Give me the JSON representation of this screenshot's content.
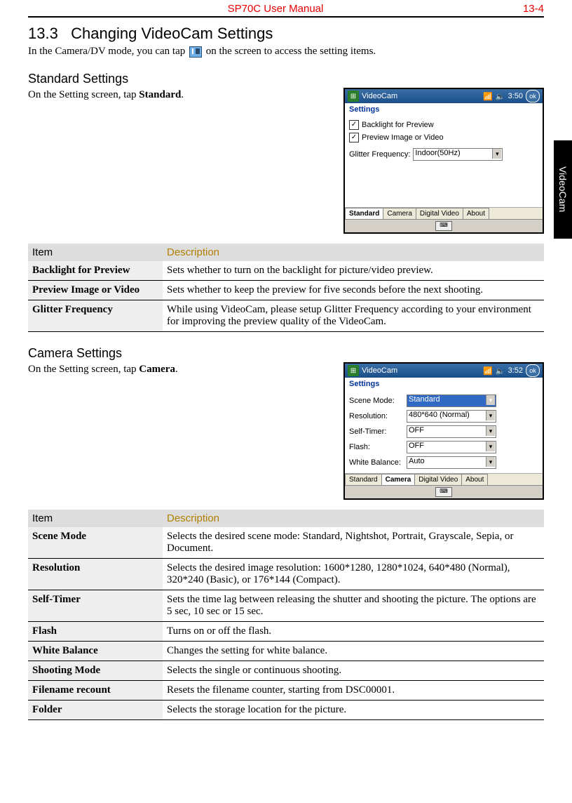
{
  "header": {
    "title": "SP70C User Manual",
    "page_num": "13-4"
  },
  "sidetab": "VideoCam",
  "section": {
    "num": "13.3",
    "title": "Changing VideoCam Settings",
    "intro_prefix": "In the Camera/DV mode, you can tap ",
    "intro_suffix": "on the screen to access the setting items."
  },
  "standard": {
    "heading": "Standard Settings",
    "lead_prefix": "On the Setting screen, tap ",
    "lead_bold": "Standard",
    "lead_suffix": ".",
    "th_item": "Item",
    "th_desc": "Description",
    "rows": [
      {
        "item": "Backlight for Preview",
        "desc": "Sets whether to turn on the backlight for picture/video preview."
      },
      {
        "item": "Preview Image or Video",
        "desc": "Sets whether to keep the preview for five seconds before the next shooting."
      },
      {
        "item": "Glitter Frequency",
        "desc": "While using VideoCam, please setup Glitter Frequency according to your environment for improving the preview quality of the VideoCam."
      }
    ],
    "shot": {
      "title": "VideoCam",
      "status": "3:50",
      "ok": "ok",
      "subtitle": "Settings",
      "chk1": "Backlight for Preview",
      "chk2": "Preview Image or Video",
      "glitter_label": "Glitter Frequency:",
      "glitter_value": "Indoor(50Hz)",
      "tabs": [
        "Standard",
        "Camera",
        "Digital Video",
        "About"
      ]
    }
  },
  "camera": {
    "heading": "Camera Settings",
    "lead_prefix": "On the Setting screen, tap ",
    "lead_bold": "Camera",
    "lead_suffix": ".",
    "th_item": "Item",
    "th_desc": "Description",
    "rows": [
      {
        "item": "Scene Mode",
        "desc": "Selects the desired scene mode: Standard, Nightshot, Portrait, Grayscale, Sepia, or Document."
      },
      {
        "item": "Resolution",
        "desc": "Selects the desired image resolution: 1600*1280, 1280*1024, 640*480 (Normal), 320*240 (Basic), or 176*144 (Compact)."
      },
      {
        "item": "Self-Timer",
        "desc": "Sets the time lag between releasing the shutter and shooting the picture. The options are 5 sec, 10 sec or 15 sec."
      },
      {
        "item": "Flash",
        "desc": "Turns on or off the flash."
      },
      {
        "item": "White Balance",
        "desc": "Changes the setting for white balance."
      },
      {
        "item": "Shooting Mode",
        "desc": "Selects the single or continuous shooting."
      },
      {
        "item": "Filename recount",
        "desc": "Resets the filename counter, starting from DSC00001."
      },
      {
        "item": "Folder",
        "desc": "Selects the storage location for the picture."
      }
    ],
    "shot": {
      "title": "VideoCam",
      "status": "3:52",
      "ok": "ok",
      "subtitle": "Settings",
      "fields": [
        {
          "label": "Scene Mode:",
          "value": "Standard",
          "selected": true
        },
        {
          "label": "Resolution:",
          "value": "480*640 (Normal)"
        },
        {
          "label": "Self-Timer:",
          "value": "OFF"
        },
        {
          "label": "Flash:",
          "value": "OFF"
        },
        {
          "label": "White Balance:",
          "value": "Auto"
        }
      ],
      "tabs": [
        "Standard",
        "Camera",
        "Digital Video",
        "About"
      ]
    }
  }
}
